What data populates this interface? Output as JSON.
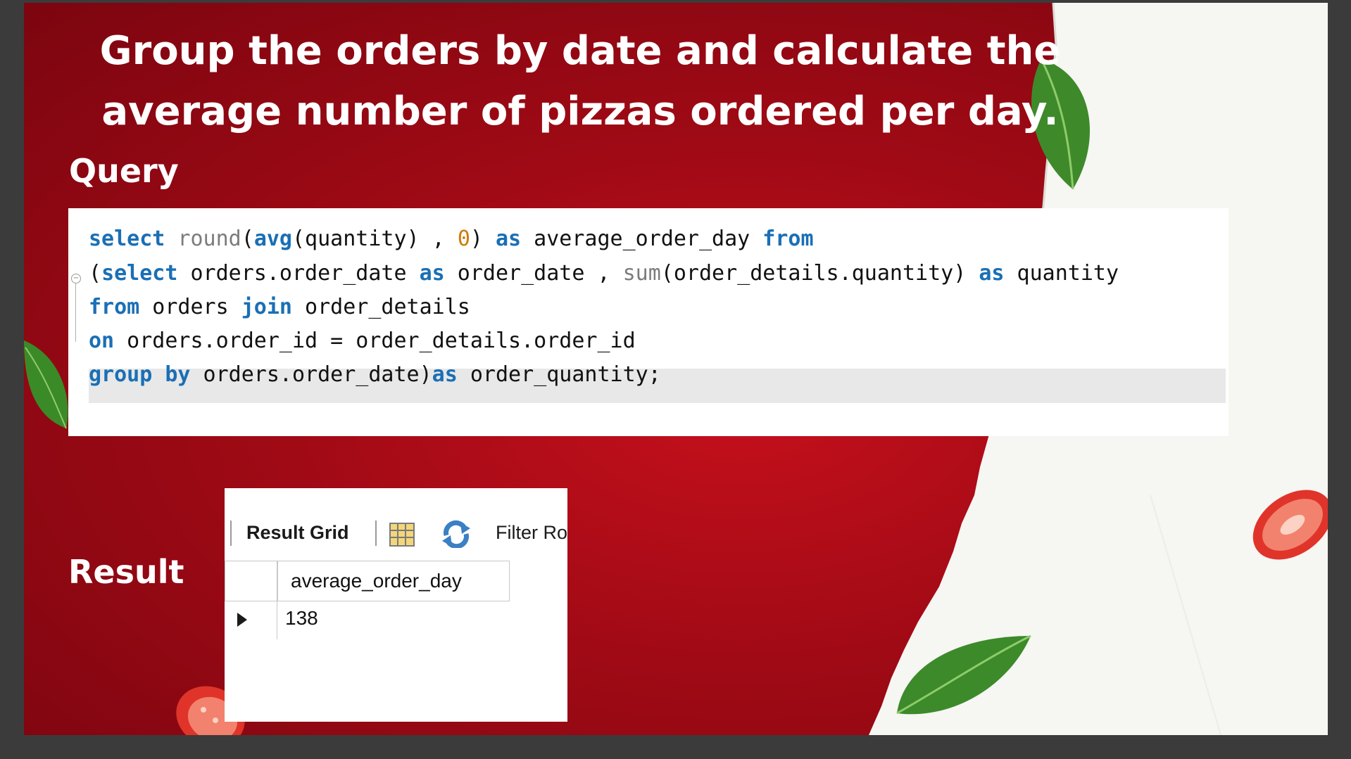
{
  "title": {
    "line1": "Group the orders by date and calculate the",
    "line2": "average number of pizzas ordered per day."
  },
  "query_label": "Query",
  "result_label": "Result",
  "code": {
    "lines": [
      [
        {
          "t": "select",
          "c": "kw"
        },
        {
          "t": " "
        },
        {
          "t": "round",
          "c": "fn"
        },
        {
          "t": "("
        },
        {
          "t": "avg",
          "c": "kw"
        },
        {
          "t": "(quantity) , "
        },
        {
          "t": "0",
          "c": "num"
        },
        {
          "t": ") "
        },
        {
          "t": "as",
          "c": "kw"
        },
        {
          "t": " average_order_day "
        },
        {
          "t": "from",
          "c": "kw"
        }
      ],
      [
        {
          "t": "("
        },
        {
          "t": "select",
          "c": "kw"
        },
        {
          "t": " orders.order_date "
        },
        {
          "t": "as",
          "c": "kw"
        },
        {
          "t": " order_date , "
        },
        {
          "t": "sum",
          "c": "fn"
        },
        {
          "t": "(order_details.quantity) "
        },
        {
          "t": "as",
          "c": "kw"
        },
        {
          "t": " quantity"
        }
      ],
      [
        {
          "t": "from",
          "c": "kw"
        },
        {
          "t": " orders "
        },
        {
          "t": "join",
          "c": "kw"
        },
        {
          "t": " order_details"
        }
      ],
      [
        {
          "t": "on",
          "c": "kw"
        },
        {
          "t": " orders.order_id = order_details.order_id"
        }
      ],
      [
        {
          "t": "group by",
          "c": "kw"
        },
        {
          "t": " orders.order_date)"
        },
        {
          "t": "as",
          "c": "kw"
        },
        {
          "t": " order_quantity;"
        }
      ]
    ]
  },
  "result": {
    "toolbar": {
      "result_grid_label": "Result Grid",
      "filter_label": "Filter Ro"
    },
    "column_header": "average_order_day",
    "rows": [
      [
        "138"
      ]
    ]
  },
  "colors": {
    "background_red": "#a00a15",
    "keyword_blue": "#1a6fb5",
    "number_orange": "#d07a0a"
  },
  "icons": [
    "grid-columns-icon",
    "refresh-icon",
    "row-pointer-icon",
    "fold-marker-icon"
  ]
}
